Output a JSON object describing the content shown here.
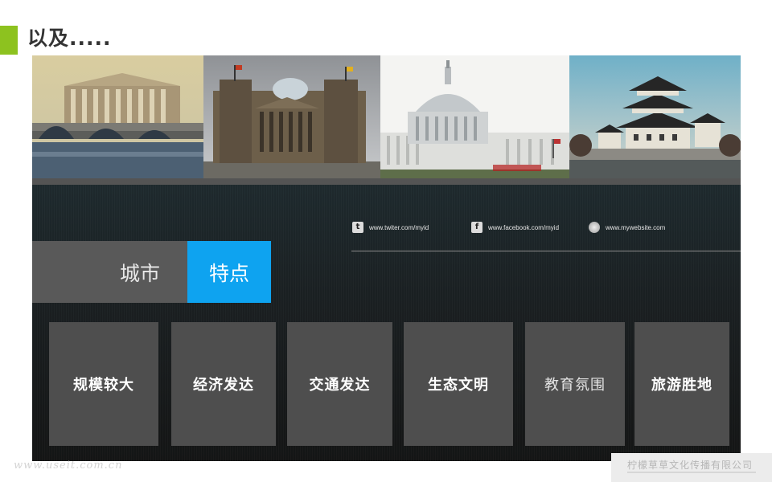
{
  "slide": {
    "title": "以及.....",
    "accent_color": "#8dc21f"
  },
  "photos": [
    {
      "name": "photo-palais-bourbon",
      "subject": "Paris Palais Bourbon"
    },
    {
      "name": "photo-reichstag",
      "subject": "Berlin Reichstag"
    },
    {
      "name": "photo-us-capitol",
      "subject": "Washington US Capitol"
    },
    {
      "name": "photo-japanese-castle",
      "subject": "Japanese castle"
    }
  ],
  "social": {
    "twitter": {
      "icon": "twitter-icon",
      "text": "www.twiter.com/myid"
    },
    "facebook": {
      "icon": "facebook-icon",
      "text": "www.facebook.com/myid"
    },
    "website": {
      "icon": "globe-icon",
      "text": "www.mywebsite.com"
    }
  },
  "tabs": {
    "city": "城市",
    "feature": "特点",
    "active_color": "#0ea3f0"
  },
  "cards": [
    "规模较大",
    "经济发达",
    "交通发达",
    "生态文明",
    "教育氛围",
    "旅游胜地"
  ],
  "footer": {
    "left": "www.useit.com.cn",
    "right": "柠檬草草文化传播有限公司"
  }
}
